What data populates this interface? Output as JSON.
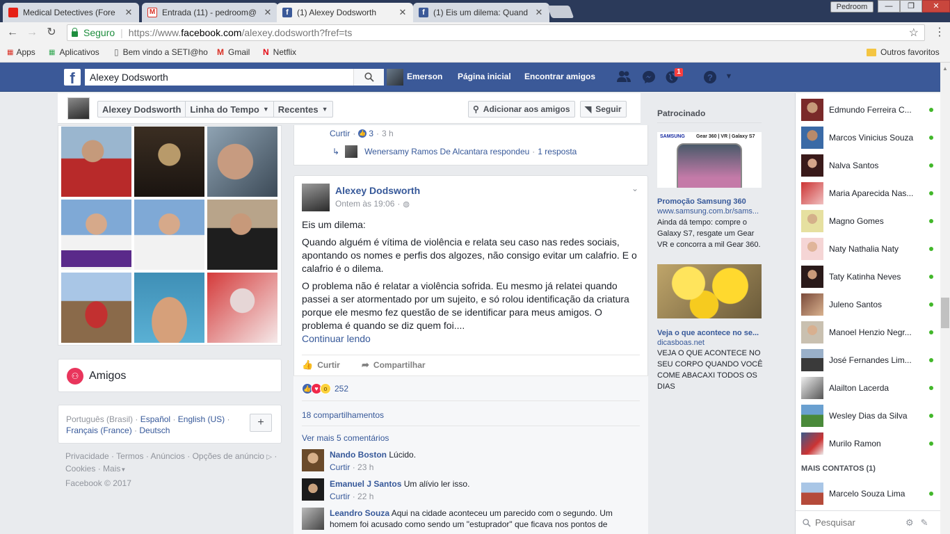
{
  "browser": {
    "tabs": [
      {
        "title": "Medical Detectives (Fore",
        "icon": "youtube-icon",
        "active": false
      },
      {
        "title": "Entrada (11) - pedroom@",
        "icon": "gmail-icon",
        "active": false
      },
      {
        "title": "(1) Alexey Dodsworth",
        "icon": "facebook-icon",
        "active": true
      },
      {
        "title": "(1) Eis um dilema: Quand",
        "icon": "facebook-icon",
        "active": false
      }
    ],
    "profile": "Pedroom",
    "secure_label": "Seguro",
    "url_prefix": "https://www.",
    "url_domain": "facebook.com",
    "url_path": "/alexey.dodsworth?fref=ts",
    "bookmarks": [
      {
        "label": "Apps",
        "icon": "apps-grid-icon"
      },
      {
        "label": "Aplicativos",
        "icon": "apps-grid-icon"
      },
      {
        "label": "Bem vindo a SETI@ho",
        "icon": "document-icon"
      },
      {
        "label": "Gmail",
        "icon": "gmail-icon"
      },
      {
        "label": "Netflix",
        "icon": "netflix-icon"
      }
    ],
    "other_bookmarks": "Outros favoritos"
  },
  "fb_header": {
    "search_value": "Alexey Dodsworth",
    "user_name": "Emerson",
    "home": "Página inicial",
    "find_friends": "Encontrar amigos",
    "notif_count": "1"
  },
  "timeline_bar": {
    "name": "Alexey Dodsworth",
    "timeline": "Linha do Tempo",
    "recent": "Recentes",
    "add_friend": "Adicionar aos amigos",
    "follow": "Seguir"
  },
  "friends_card": {
    "title": "Amigos"
  },
  "languages": {
    "current": "Português (Brasil)",
    "options": [
      "Español",
      "English (US)",
      "Français (France)",
      "Deutsch"
    ],
    "sep": "·",
    "add": "+"
  },
  "footer": {
    "links": [
      "Privacidade",
      "Termos",
      "Anúncios",
      "Opções de anúncio",
      "Cookies",
      "Mais"
    ],
    "copyright": "Facebook © 2017"
  },
  "prev_post": {
    "like": "Curtir",
    "like_count": "3",
    "time": "3 h",
    "reply": "Wenersamy Ramos De Alcantara respondeu",
    "reply_count": "1 resposta"
  },
  "post": {
    "author": "Alexey Dodsworth",
    "time": "Ontem às 19:06",
    "paragraphs": [
      "Eis um dilema:",
      "Quando alguém é vítima de violência e relata seu caso nas redes sociais, apontando os nomes e perfis dos algozes, não consigo evitar um calafrio. E o calafrio é o dilema.",
      "O problema não é relatar a violência sofrida. Eu mesmo já relatei quando passei a ser atormentado por um sujeito, e só rolou identificação da criatura porque ele mesmo fez questão de se identificar para meus amigos. O problema é quando se diz quem foi...."
    ],
    "continue": "Continuar lendo",
    "like": "Curtir",
    "share": "Compartilhar",
    "reaction_count": "252",
    "shares": "18 compartilhamentos",
    "more_comments": "Ver mais 5 comentários"
  },
  "comments": [
    {
      "name": "Nando Boston",
      "text": "Lúcido.",
      "like": "Curtir",
      "time": "23 h"
    },
    {
      "name": "Emanuel J Santos",
      "text": "Um alívio ler isso.",
      "like": "Curtir",
      "time": "22 h"
    },
    {
      "name": "Leandro Souza",
      "text": "Aqui na cidade aconteceu um parecido com o segundo. Um homem foi acusado como sendo um \"estuprador\" que ficava nos pontos de",
      "like": "",
      "time": ""
    }
  ],
  "sponsored": {
    "title": "Patrocinado",
    "ad1": {
      "banner": "SAMSUNG",
      "banner_tag": "Gear 360 | VR | Galaxy S7",
      "headline": "Promoção Samsung 360",
      "domain": "www.samsung.com.br/sams...",
      "text": "Ainda dá tempo: compre o Galaxy S7, resgate um Gear VR e concorra a mil Gear 360."
    },
    "ad2": {
      "headline": "Veja o que acontece no se...",
      "domain": "dicasboas.net",
      "text": "VEJA O QUE ACONTECE NO SEU CORPO QUANDO VOCÊ COME ABACAXI TODOS OS DIAS"
    }
  },
  "chat": {
    "contacts": [
      "Edmundo Ferreira C...",
      "Marcos Vinicius Souza",
      "Nalva Santos",
      "Maria Aparecida Nas...",
      "Magno Gomes",
      "Naty Nathalia Naty",
      "Taty Katinha Neves",
      "Juleno Santos",
      "Manoel Henzio Negr...",
      "José Fernandes Lim...",
      "Alailton Lacerda",
      "Wesley Dias da Silva",
      "Murilo Ramon"
    ],
    "more_header": "MAIS CONTATOS (1)",
    "more_contacts": [
      "Marcelo Souza Lima"
    ],
    "search_placeholder": "Pesquisar"
  },
  "colors": {
    "fb_blue": "#3b5998",
    "link": "#365899",
    "online": "#42b72a",
    "secure": "#1e8e3e"
  }
}
